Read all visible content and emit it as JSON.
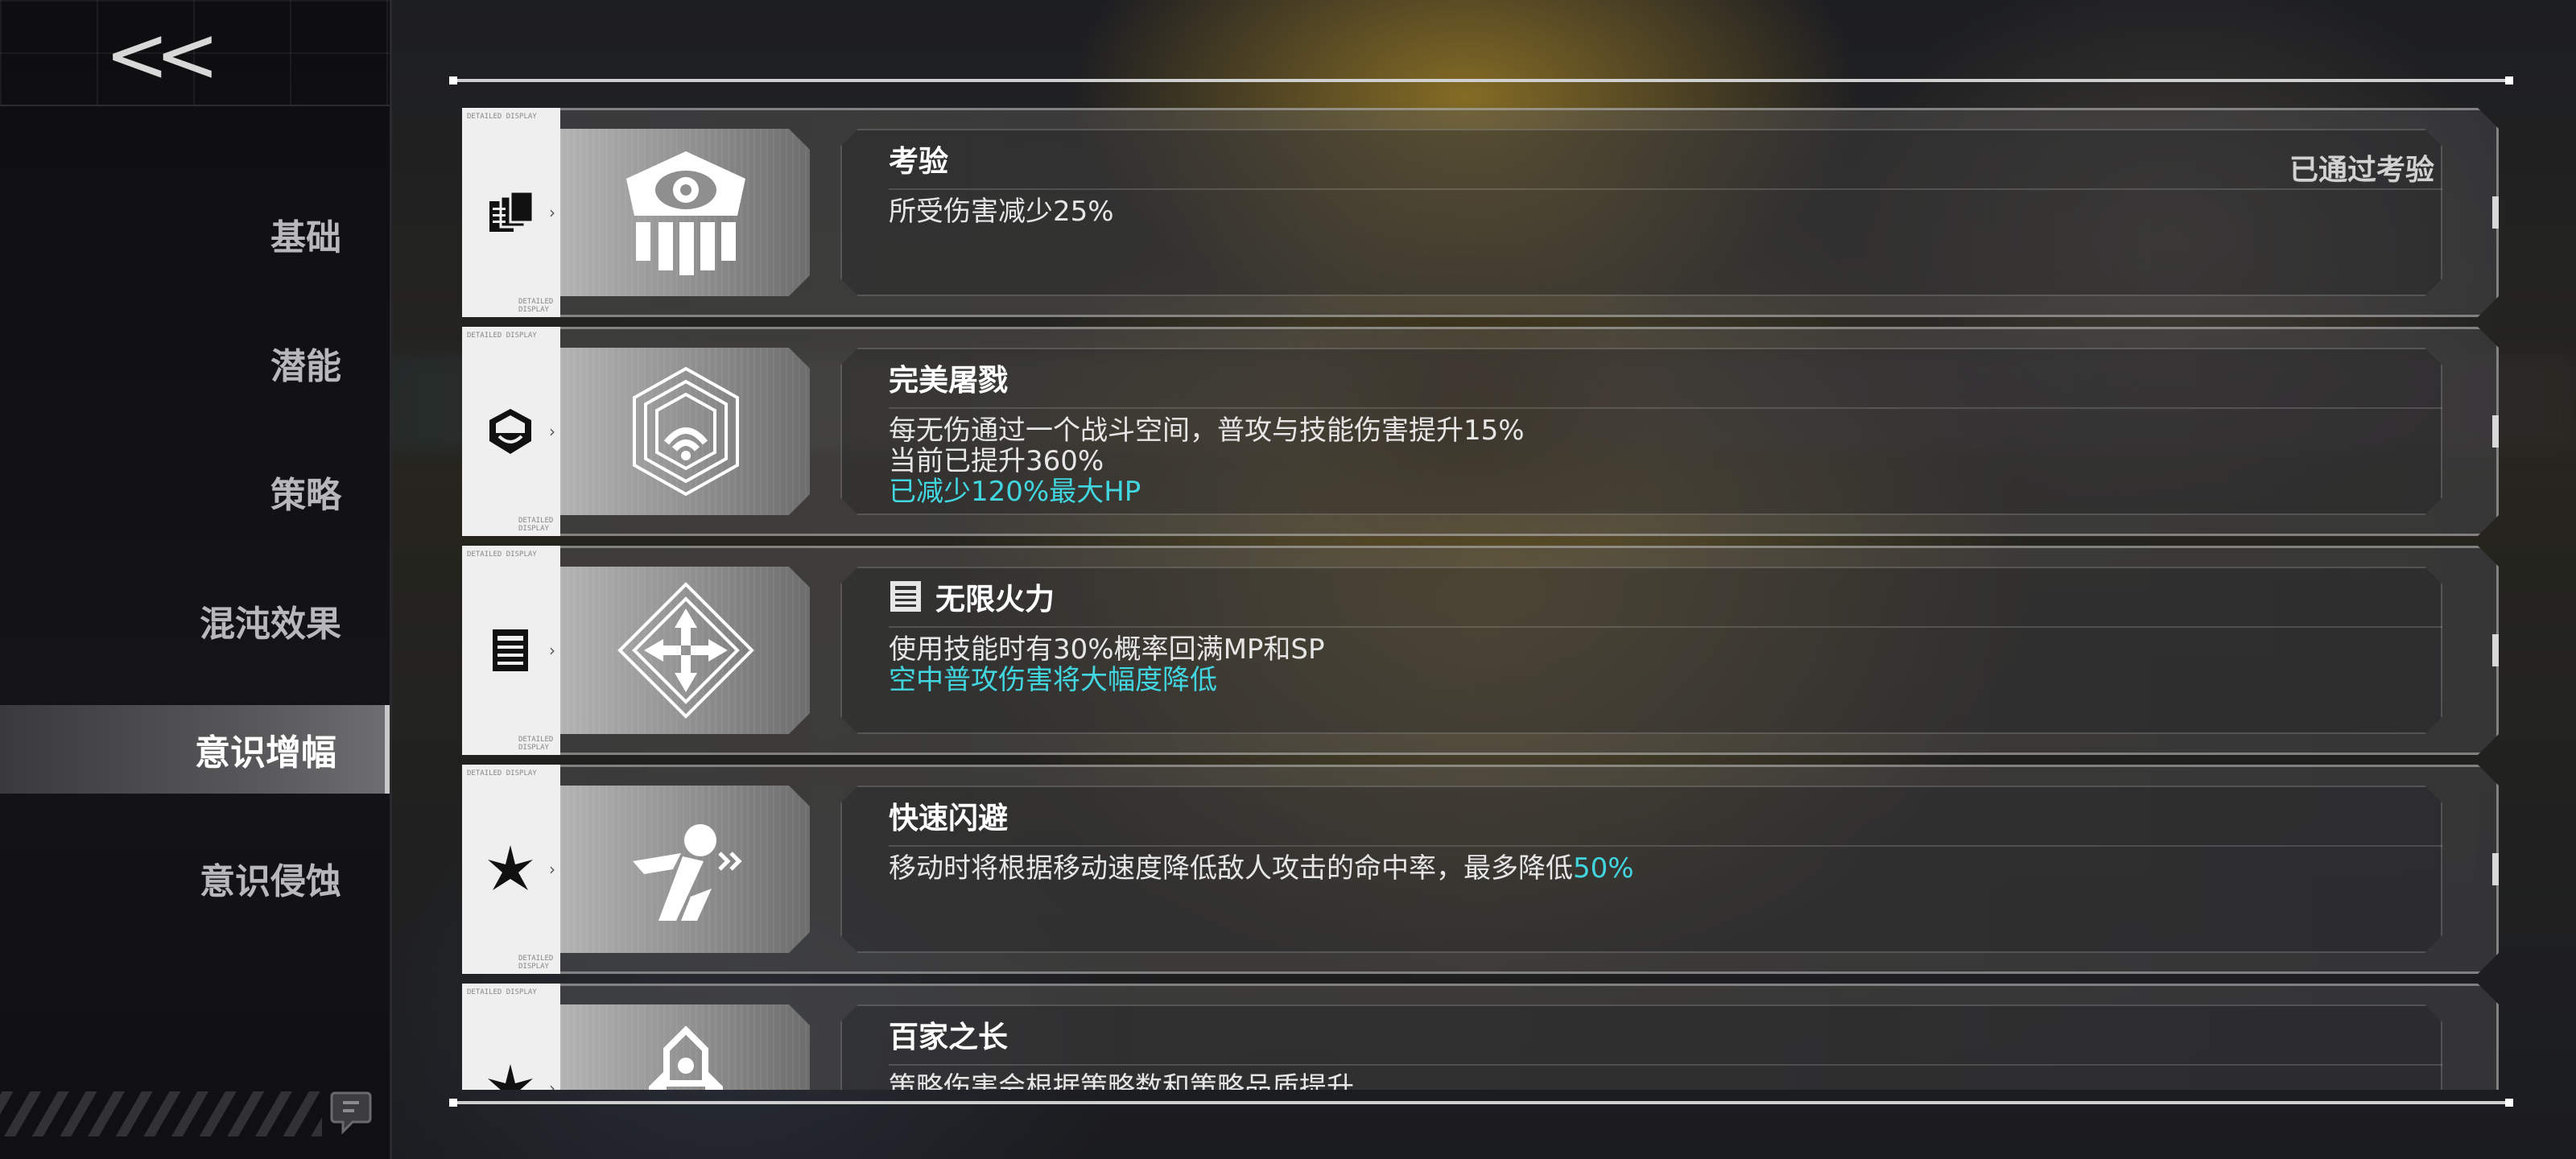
{
  "sidebar": {
    "back_label": "<<",
    "items": [
      {
        "label": "基础",
        "active": false
      },
      {
        "label": "潜能",
        "active": false
      },
      {
        "label": "策略",
        "active": false
      },
      {
        "label": "混沌效果",
        "active": false
      },
      {
        "label": "意识增幅",
        "active": true
      },
      {
        "label": "意识侵蚀",
        "active": false
      }
    ]
  },
  "cards": [
    {
      "title": "考验",
      "status": "已通过考验",
      "lines": [
        "所受伤害减少25%"
      ],
      "icon": "eye-temple-icon",
      "small_icon": "cards-stack-icon"
    },
    {
      "title": "完美屠戮",
      "lines": [
        "每无伤通过一个战斗空间，普攻与技能伤害提升15%",
        "当前已提升360%"
      ],
      "highlight_line": "已减少120%最大HP",
      "icon": "hex-signal-icon",
      "small_icon": "helmet-icon"
    },
    {
      "title": "无限火力",
      "lines": [
        "使用技能时有30%概率回满MP和SP"
      ],
      "highlight_line": "空中普攻伤害将大幅度降低",
      "icon": "diamond-arrows-icon",
      "small_icon": "mask-icon"
    },
    {
      "title": "快速闪避",
      "desc_prefix": "移动时将根据移动速度降低敌人攻击的命中率，最多降低",
      "desc_highlight": "50%",
      "icon": "running-figure-icon",
      "small_icon": "star-burst-icon"
    },
    {
      "title": "百家之长",
      "lines": [
        "策略伤害会根据策略数和策略品质提升"
      ],
      "icon": "rocket-shield-icon",
      "small_icon": "star-burst-icon"
    }
  ],
  "tiny_text": {
    "top": "DETAILED DISPLAY",
    "bottom": "DETAILED DISPLAY"
  }
}
